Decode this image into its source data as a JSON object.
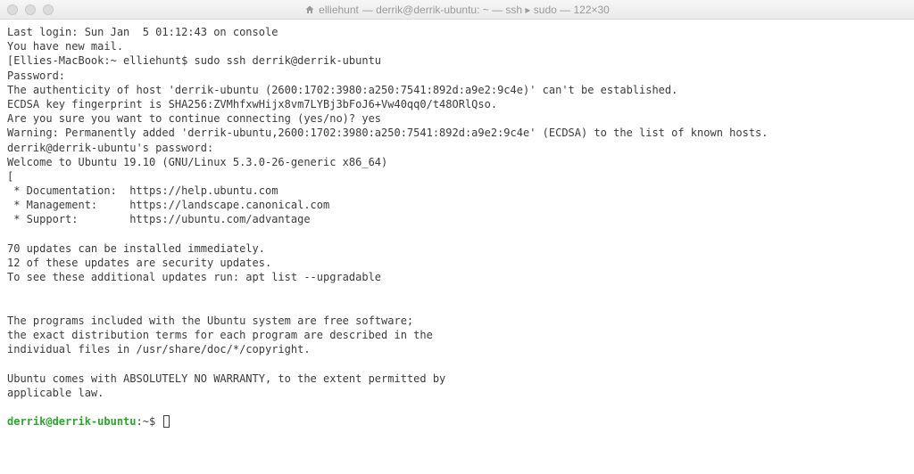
{
  "title": {
    "folder": "elliehunt",
    "rest": " — derrik@derrik-ubuntu: ~ — ssh ▸ sudo — 122×30"
  },
  "lines": {
    "l0": "Last login: Sun Jan  5 01:12:43 on console",
    "l1": "You have new mail.",
    "l2_prompt": "[Ellies-MacBook:~ elliehunt$ ",
    "l2_cmd": "sudo ssh derrik@derrik-ubuntu",
    "l3": "Password:",
    "l4": "The authenticity of host 'derrik-ubuntu (2600:1702:3980:a250:7541:892d:a9e2:9c4e)' can't be established.",
    "l5": "ECDSA key fingerprint is SHA256:ZVMhfxwHijx8vm7LYBj3bFoJ6+Vw40qq0/t48ORlQso.",
    "l6": "Are you sure you want to continue connecting (yes/no)? yes",
    "l7": "Warning: Permanently added 'derrik-ubuntu,2600:1702:3980:a250:7541:892d:a9e2:9c4e' (ECDSA) to the list of known hosts.",
    "l8": "derrik@derrik-ubuntu's password:",
    "l9": "Welcome to Ubuntu 19.10 (GNU/Linux 5.3.0-26-generic x86_64)",
    "l10": "[",
    "l11": " * Documentation:  https://help.ubuntu.com",
    "l12": " * Management:     https://landscape.canonical.com",
    "l13": " * Support:        https://ubuntu.com/advantage",
    "l14": "70 updates can be installed immediately.",
    "l15": "12 of these updates are security updates.",
    "l16": "To see these additional updates run: apt list --upgradable",
    "l17": "The programs included with the Ubuntu system are free software;",
    "l18": "the exact distribution terms for each program are described in the",
    "l19": "individual files in /usr/share/doc/*/copyright.",
    "l20": "Ubuntu comes with ABSOLUTELY NO WARRANTY, to the extent permitted by",
    "l21": "applicable law.",
    "prompt_user": "derrik@derrik-ubuntu",
    "prompt_path": ":~$ "
  }
}
